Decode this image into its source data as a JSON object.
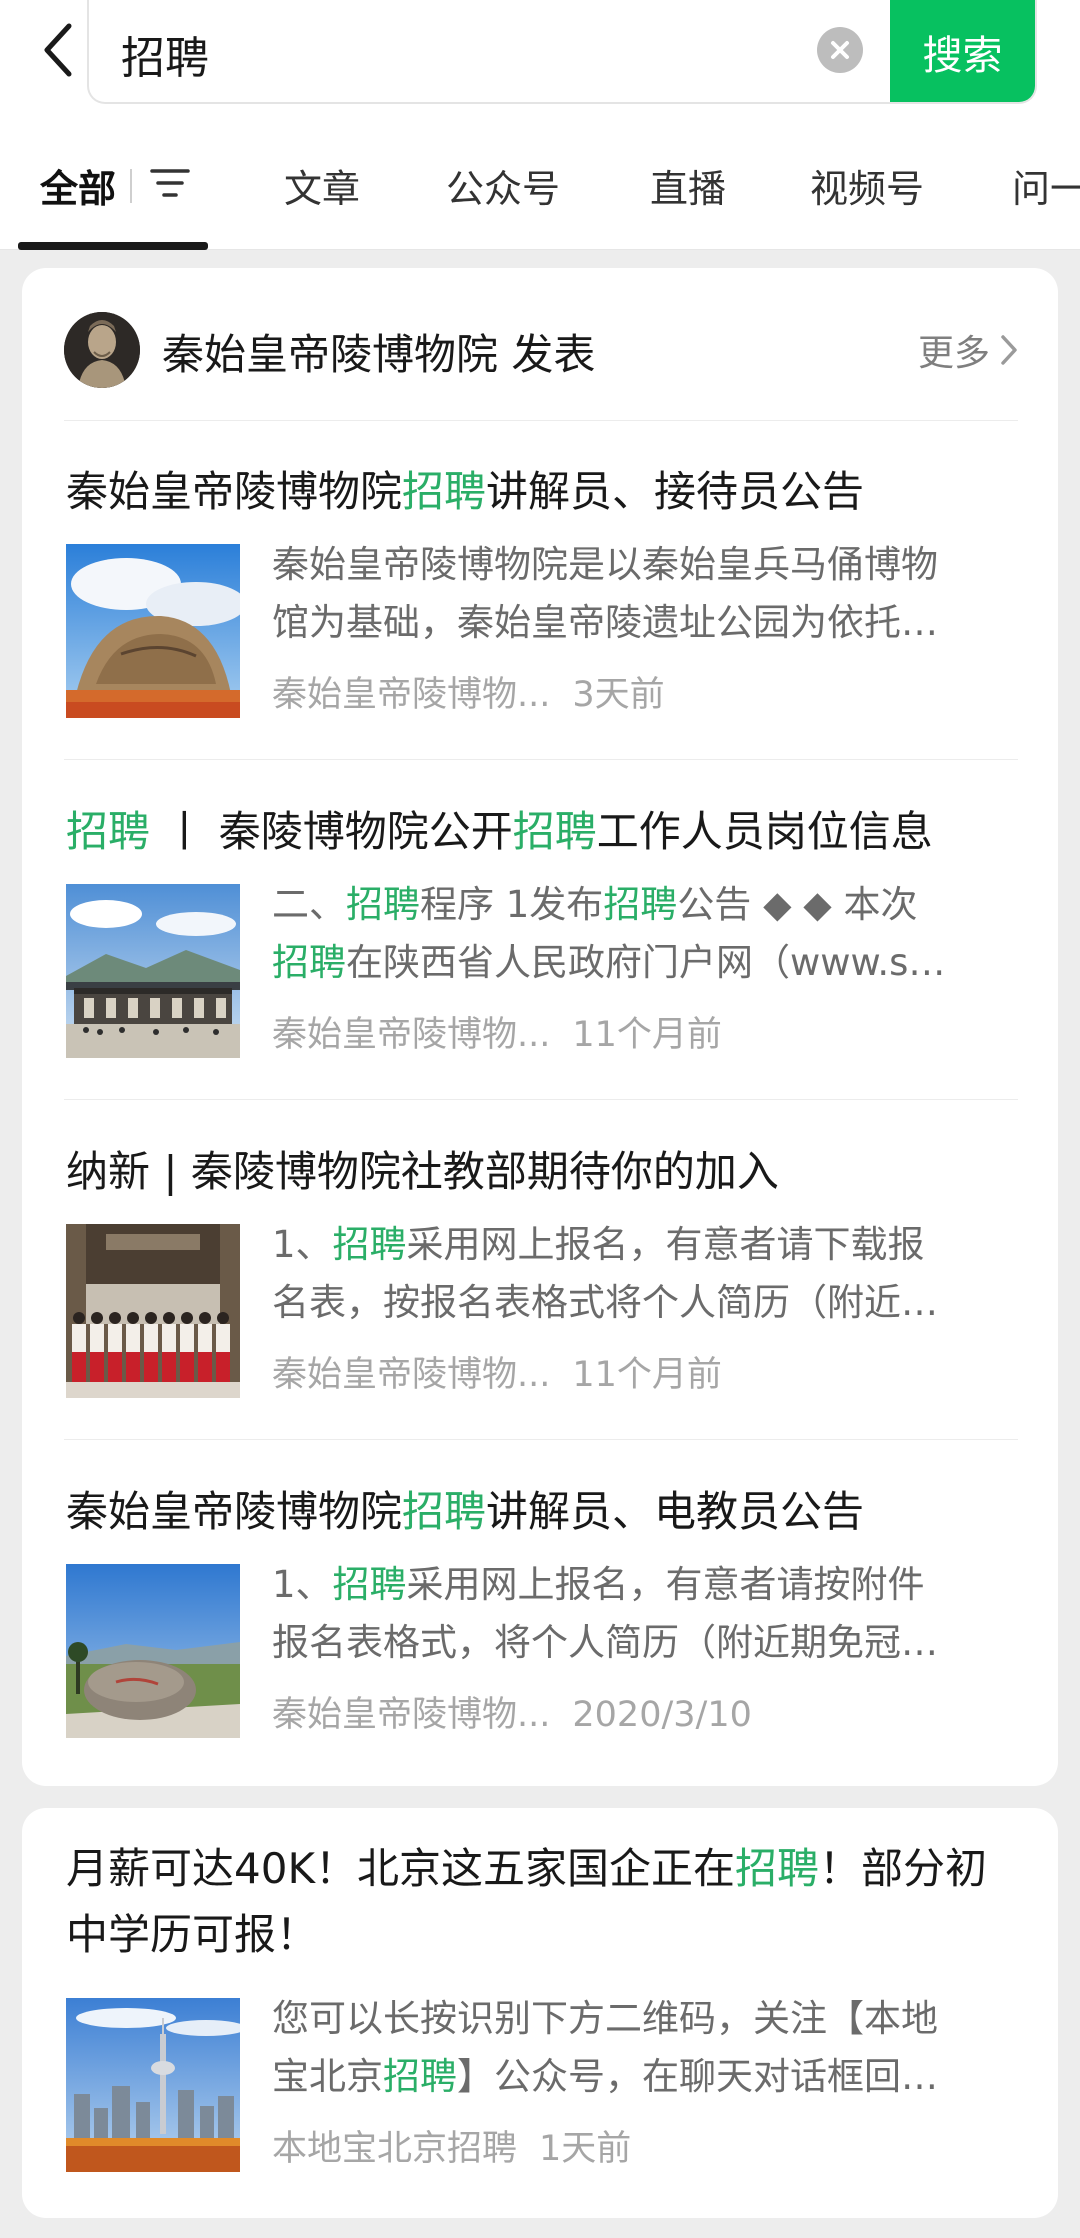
{
  "search": {
    "query": "招聘",
    "button_label": "搜索"
  },
  "tabs": [
    {
      "label": "全部",
      "active": true
    },
    {
      "label": "文章"
    },
    {
      "label": "公众号"
    },
    {
      "label": "直播"
    },
    {
      "label": "视频号"
    },
    {
      "label": "问一"
    }
  ],
  "publisher": {
    "name": "秦始皇帝陵博物院 发表",
    "more_label": "更多"
  },
  "articles": [
    {
      "title": [
        {
          "t": "秦始皇帝陵博物院"
        },
        {
          "t": "招聘",
          "hl": true
        },
        {
          "t": "讲解员、接待员公告"
        }
      ],
      "snippet_lines": [
        [
          {
            "t": "秦始皇帝陵博物院是以秦始皇兵马俑博物"
          }
        ],
        [
          {
            "t": "馆为基础，秦始皇帝陵遗址公园为依托…"
          }
        ]
      ],
      "source": "秦始皇帝陵博物...",
      "date": "3天前",
      "thumb": "monument"
    },
    {
      "title": [
        {
          "t": "招聘",
          "hl": true
        },
        {
          "t": " 丨 秦陵博物院公开"
        },
        {
          "t": "招聘",
          "hl": true
        },
        {
          "t": "工作人员岗位信息"
        }
      ],
      "snippet_lines": [
        [
          {
            "t": "二、"
          },
          {
            "t": "招聘",
            "hl": true
          },
          {
            "t": "程序 1发布"
          },
          {
            "t": "招聘",
            "hl": true
          },
          {
            "t": "公告 ◆ ◆ 本次"
          }
        ],
        [
          {
            "t": "招聘",
            "hl": true
          },
          {
            "t": "在陕西省人民政府门户网（www.s…"
          }
        ]
      ],
      "source": "秦始皇帝陵博物...",
      "date": "11个月前",
      "thumb": "building"
    },
    {
      "title": [
        {
          "t": "纳新 | 秦陵博物院社教部期待你的加入"
        }
      ],
      "snippet_lines": [
        [
          {
            "t": "1、"
          },
          {
            "t": "招聘",
            "hl": true
          },
          {
            "t": "采用网上报名，有意者请下载报"
          }
        ],
        [
          {
            "t": "名表，按报名表格式将个人简历（附近…"
          }
        ]
      ],
      "source": "秦始皇帝陵博物...",
      "date": "11个月前",
      "thumb": "group"
    },
    {
      "title": [
        {
          "t": "秦始皇帝陵博物院"
        },
        {
          "t": "招聘",
          "hl": true
        },
        {
          "t": "讲解员、电教员公告"
        }
      ],
      "snippet_lines": [
        [
          {
            "t": "1、"
          },
          {
            "t": "招聘",
            "hl": true
          },
          {
            "t": "采用网上报名，有意者请按附件"
          }
        ],
        [
          {
            "t": "报名表格式，将个人简历（附近期免冠…"
          }
        ]
      ],
      "source": "秦始皇帝陵博物...",
      "date": "2020/3/10",
      "thumb": "rock"
    }
  ],
  "card2": {
    "title": [
      {
        "t": "月薪可达40K！北京这五家国企正在"
      },
      {
        "t": "招聘",
        "hl": true
      },
      {
        "t": "！部分初中学历可报！"
      }
    ],
    "snippet_lines": [
      [
        {
          "t": "您可以长按识别下方二维码，关注【本地"
        }
      ],
      [
        {
          "t": "宝北京"
        },
        {
          "t": "招聘",
          "hl": true
        },
        {
          "t": "】公众号，在聊天对话框回…"
        }
      ]
    ],
    "source": "本地宝北京招聘",
    "date": "1天前",
    "thumb": "city"
  },
  "icons": {
    "back": "back-arrow-icon",
    "clear": "clear-icon",
    "filter": "filter-icon",
    "chevron": "chevron-right-icon"
  },
  "colors": {
    "accent": "#07c160",
    "highlight": "#2aae67"
  }
}
